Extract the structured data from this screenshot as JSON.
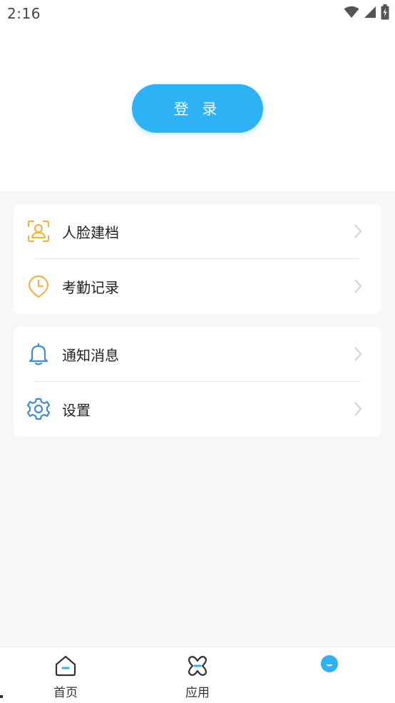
{
  "statusbar": {
    "time": "2:16",
    "icons": [
      "wifi-icon",
      "signal-icon",
      "battery-charging-icon"
    ]
  },
  "header": {
    "login_label": "登 录"
  },
  "menu_groups": [
    {
      "items": [
        {
          "label": "人脸建档",
          "icon": "face-profile-icon"
        },
        {
          "label": "考勤记录",
          "icon": "clock-icon"
        }
      ]
    },
    {
      "items": [
        {
          "label": "通知消息",
          "icon": "bell-icon"
        },
        {
          "label": "设置",
          "icon": "gear-icon"
        }
      ]
    }
  ],
  "tabbar": {
    "tabs": [
      {
        "label": "首页",
        "icon": "home-icon"
      },
      {
        "label": "应用",
        "icon": "apps-icon"
      },
      {
        "label": "",
        "icon": "mine-icon",
        "active": true
      }
    ]
  },
  "colors": {
    "accent": "#2db2f5",
    "orange": "#f2b445",
    "blue_icon": "#3d8bd9",
    "background": "#f7f7f7",
    "card": "#ffffff"
  }
}
